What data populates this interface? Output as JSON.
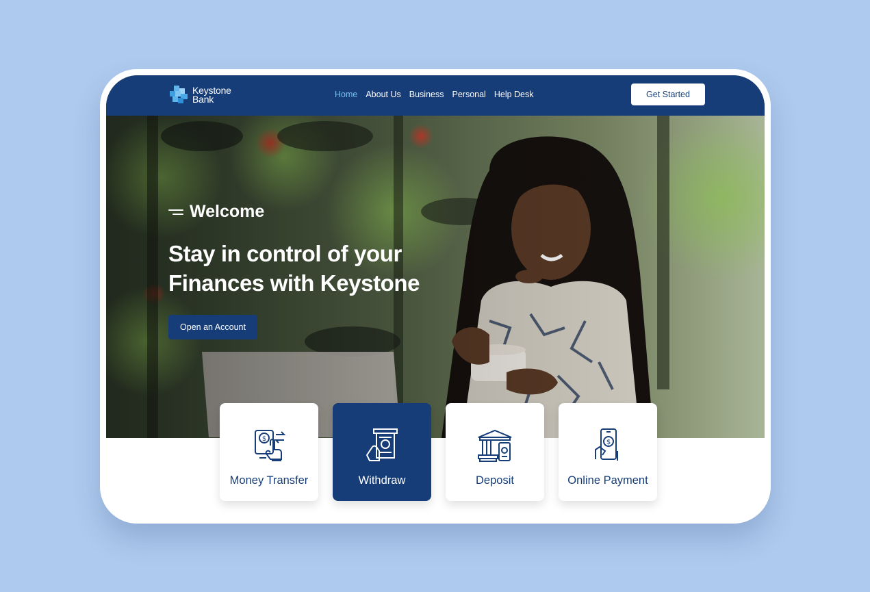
{
  "brand": {
    "line1": "Keystone",
    "line2": "Bank"
  },
  "nav": {
    "items": [
      {
        "label": "Home",
        "active": true
      },
      {
        "label": "About Us",
        "active": false
      },
      {
        "label": "Business",
        "active": false
      },
      {
        "label": "Personal",
        "active": false
      },
      {
        "label": "Help Desk",
        "active": false
      }
    ],
    "cta_label": "Get Started"
  },
  "hero": {
    "welcome": "Welcome",
    "headline_line1": "Stay in control of your",
    "headline_line2": "Finances with Keystone",
    "button_label": "Open an Account",
    "image": "smiling woman holding a coffee cup in a plant-filled cafe"
  },
  "services": [
    {
      "label": "Money Transfer",
      "icon": "money-transfer-icon",
      "selected": false
    },
    {
      "label": "Withdraw",
      "icon": "atm-withdraw-icon",
      "selected": true
    },
    {
      "label": "Deposit",
      "icon": "bank-deposit-icon",
      "selected": false
    },
    {
      "label": "Online Payment",
      "icon": "phone-payment-icon",
      "selected": false
    }
  ],
  "colors": {
    "navy": "#163d78",
    "accent_blue": "#7cc0f2",
    "page_bg": "#aecaee",
    "white": "#ffffff"
  }
}
